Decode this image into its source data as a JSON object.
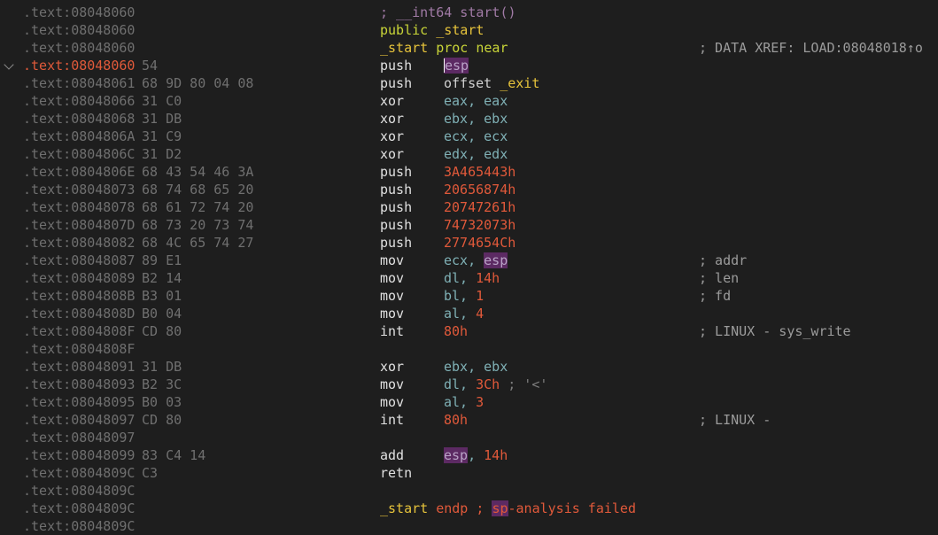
{
  "segment": ".text:",
  "lines": [
    {
      "addr": "08048060",
      "bytes": "",
      "parts": [
        {
          "t": "; __int64 start()",
          "c": "c-head"
        }
      ]
    },
    {
      "addr": "08048060",
      "bytes": "",
      "parts": [
        {
          "t": "public ",
          "c": "c-kw"
        },
        {
          "t": "_start",
          "c": "c-name"
        }
      ]
    },
    {
      "addr": "08048060",
      "bytes": "",
      "parts": [
        {
          "t": "_start",
          "c": "c-name"
        },
        {
          "t": " proc near",
          "c": "c-kw"
        }
      ],
      "comment": "; DATA XREF: LOAD:08048018↑o"
    },
    {
      "addr": "08048060",
      "bytes": "54",
      "current": true,
      "mnemonic": "push",
      "ops": [
        {
          "t": "esp",
          "c": "hl",
          "caret": true
        }
      ]
    },
    {
      "addr": "08048061",
      "bytes": "68 9D 80 04 08",
      "mnemonic": "push",
      "ops": [
        {
          "t": "offset ",
          "c": "c-off"
        },
        {
          "t": "_exit",
          "c": "c-name"
        }
      ]
    },
    {
      "addr": "08048066",
      "bytes": "31 C0",
      "mnemonic": "xor",
      "ops": [
        {
          "t": "eax, eax",
          "c": "c-reg"
        }
      ]
    },
    {
      "addr": "08048068",
      "bytes": "31 DB",
      "mnemonic": "xor",
      "ops": [
        {
          "t": "ebx, ebx",
          "c": "c-reg"
        }
      ]
    },
    {
      "addr": "0804806A",
      "bytes": "31 C9",
      "mnemonic": "xor",
      "ops": [
        {
          "t": "ecx, ecx",
          "c": "c-reg"
        }
      ]
    },
    {
      "addr": "0804806C",
      "bytes": "31 D2",
      "mnemonic": "xor",
      "ops": [
        {
          "t": "edx, edx",
          "c": "c-reg"
        }
      ]
    },
    {
      "addr": "0804806E",
      "bytes": "68 43 54 46 3A",
      "mnemonic": "push",
      "ops": [
        {
          "t": "3A465443h",
          "c": "c-num"
        }
      ]
    },
    {
      "addr": "08048073",
      "bytes": "68 74 68 65 20",
      "mnemonic": "push",
      "ops": [
        {
          "t": "20656874h",
          "c": "c-num"
        }
      ]
    },
    {
      "addr": "08048078",
      "bytes": "68 61 72 74 20",
      "mnemonic": "push",
      "ops": [
        {
          "t": "20747261h",
          "c": "c-num"
        }
      ]
    },
    {
      "addr": "0804807D",
      "bytes": "68 73 20 73 74",
      "mnemonic": "push",
      "ops": [
        {
          "t": "74732073h",
          "c": "c-num"
        }
      ]
    },
    {
      "addr": "08048082",
      "bytes": "68 4C 65 74 27",
      "mnemonic": "push",
      "ops": [
        {
          "t": "2774654Ch",
          "c": "c-num"
        }
      ]
    },
    {
      "addr": "08048087",
      "bytes": "89 E1",
      "mnemonic": "mov",
      "ops": [
        {
          "t": "ecx, ",
          "c": "c-reg"
        },
        {
          "t": "esp",
          "c": "hl"
        }
      ],
      "comment": "; addr"
    },
    {
      "addr": "08048089",
      "bytes": "B2 14",
      "mnemonic": "mov",
      "ops": [
        {
          "t": "dl, ",
          "c": "c-reg"
        },
        {
          "t": "14h",
          "c": "c-num"
        }
      ],
      "comment": "; len"
    },
    {
      "addr": "0804808B",
      "bytes": "B3 01",
      "mnemonic": "mov",
      "ops": [
        {
          "t": "bl, ",
          "c": "c-reg"
        },
        {
          "t": "1",
          "c": "c-num"
        }
      ],
      "comment": "; fd"
    },
    {
      "addr": "0804808D",
      "bytes": "B0 04",
      "mnemonic": "mov",
      "ops": [
        {
          "t": "al, ",
          "c": "c-reg"
        },
        {
          "t": "4",
          "c": "c-num"
        }
      ]
    },
    {
      "addr": "0804808F",
      "bytes": "CD 80",
      "mnemonic": "int",
      "ops": [
        {
          "t": "80h",
          "c": "c-num"
        }
      ],
      "comment": "; LINUX - sys_write"
    },
    {
      "addr": "0804808F",
      "bytes": ""
    },
    {
      "addr": "08048091",
      "bytes": "31 DB",
      "mnemonic": "xor",
      "ops": [
        {
          "t": "ebx, ebx",
          "c": "c-reg"
        }
      ]
    },
    {
      "addr": "08048093",
      "bytes": "B2 3C",
      "mnemonic": "mov",
      "ops": [
        {
          "t": "dl, ",
          "c": "c-reg"
        },
        {
          "t": "3Ch",
          "c": "c-num"
        },
        {
          "t": " ; '<'",
          "c": "c-str"
        }
      ]
    },
    {
      "addr": "08048095",
      "bytes": "B0 03",
      "mnemonic": "mov",
      "ops": [
        {
          "t": "al, ",
          "c": "c-reg"
        },
        {
          "t": "3",
          "c": "c-num"
        }
      ]
    },
    {
      "addr": "08048097",
      "bytes": "CD 80",
      "mnemonic": "int",
      "ops": [
        {
          "t": "80h",
          "c": "c-num"
        }
      ],
      "comment": "; LINUX -"
    },
    {
      "addr": "08048097",
      "bytes": ""
    },
    {
      "addr": "08048099",
      "bytes": "83 C4 14",
      "mnemonic": "add",
      "ops": [
        {
          "t": "esp",
          "c": "hl"
        },
        {
          "t": ", ",
          "c": "c-reg"
        },
        {
          "t": "14h",
          "c": "c-num"
        }
      ]
    },
    {
      "addr": "0804809C",
      "bytes": "C3",
      "mnemonic": "retn",
      "ops": []
    },
    {
      "addr": "0804809C",
      "bytes": ""
    },
    {
      "addr": "0804809C",
      "bytes": "",
      "parts": [
        {
          "t": "_start",
          "c": "c-name"
        },
        {
          "t": " endp ; ",
          "c": "c-end"
        },
        {
          "t": "sp",
          "c": "hl-end"
        },
        {
          "t": "-analysis failed",
          "c": "c-end"
        }
      ]
    },
    {
      "addr": "0804809C",
      "bytes": ""
    }
  ]
}
